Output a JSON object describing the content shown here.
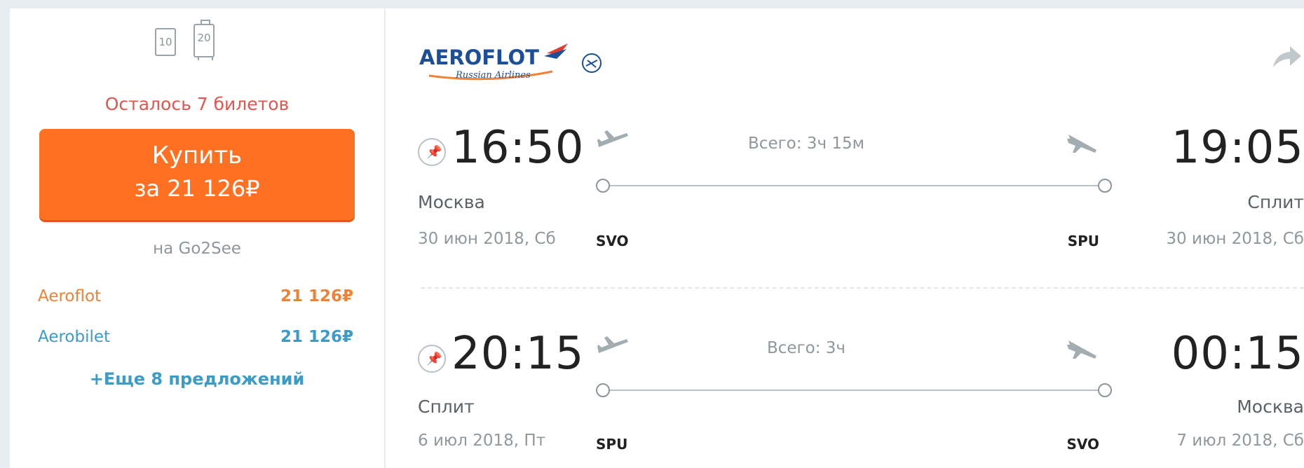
{
  "baggage": {
    "hand": "10",
    "checked": "20"
  },
  "tickets_left": "Осталось 7 билетов",
  "buy": {
    "label": "Купить",
    "price": "за 21 126₽"
  },
  "via": "на Go2See",
  "offers": [
    {
      "name": "Aeroflot",
      "price": "21 126₽"
    },
    {
      "name": "Aerobilet",
      "price": "21 126₽"
    }
  ],
  "more_offers": "+Еще 8 предложений",
  "airline": {
    "name": "AEROFLOT",
    "subtitle": "Russian Airlines"
  },
  "colors": {
    "accent": "#ff7022",
    "link": "#3a9cc7",
    "alert": "#e2564f"
  },
  "legs": [
    {
      "dep_time": "16:50",
      "dep_city": "Москва",
      "dep_date": "30 июн 2018, Сб",
      "dep_code": "SVO",
      "duration": "Всего: 3ч 15м",
      "arr_time": "19:05",
      "arr_city": "Сплит",
      "arr_date": "30 июн 2018, Сб",
      "arr_code": "SPU"
    },
    {
      "dep_time": "20:15",
      "dep_city": "Сплит",
      "dep_date": "6 июл 2018, Пт",
      "dep_code": "SPU",
      "duration": "Всего: 3ч",
      "arr_time": "00:15",
      "arr_city": "Москва",
      "arr_date": "7 июл 2018, Сб",
      "arr_code": "SVO"
    }
  ]
}
